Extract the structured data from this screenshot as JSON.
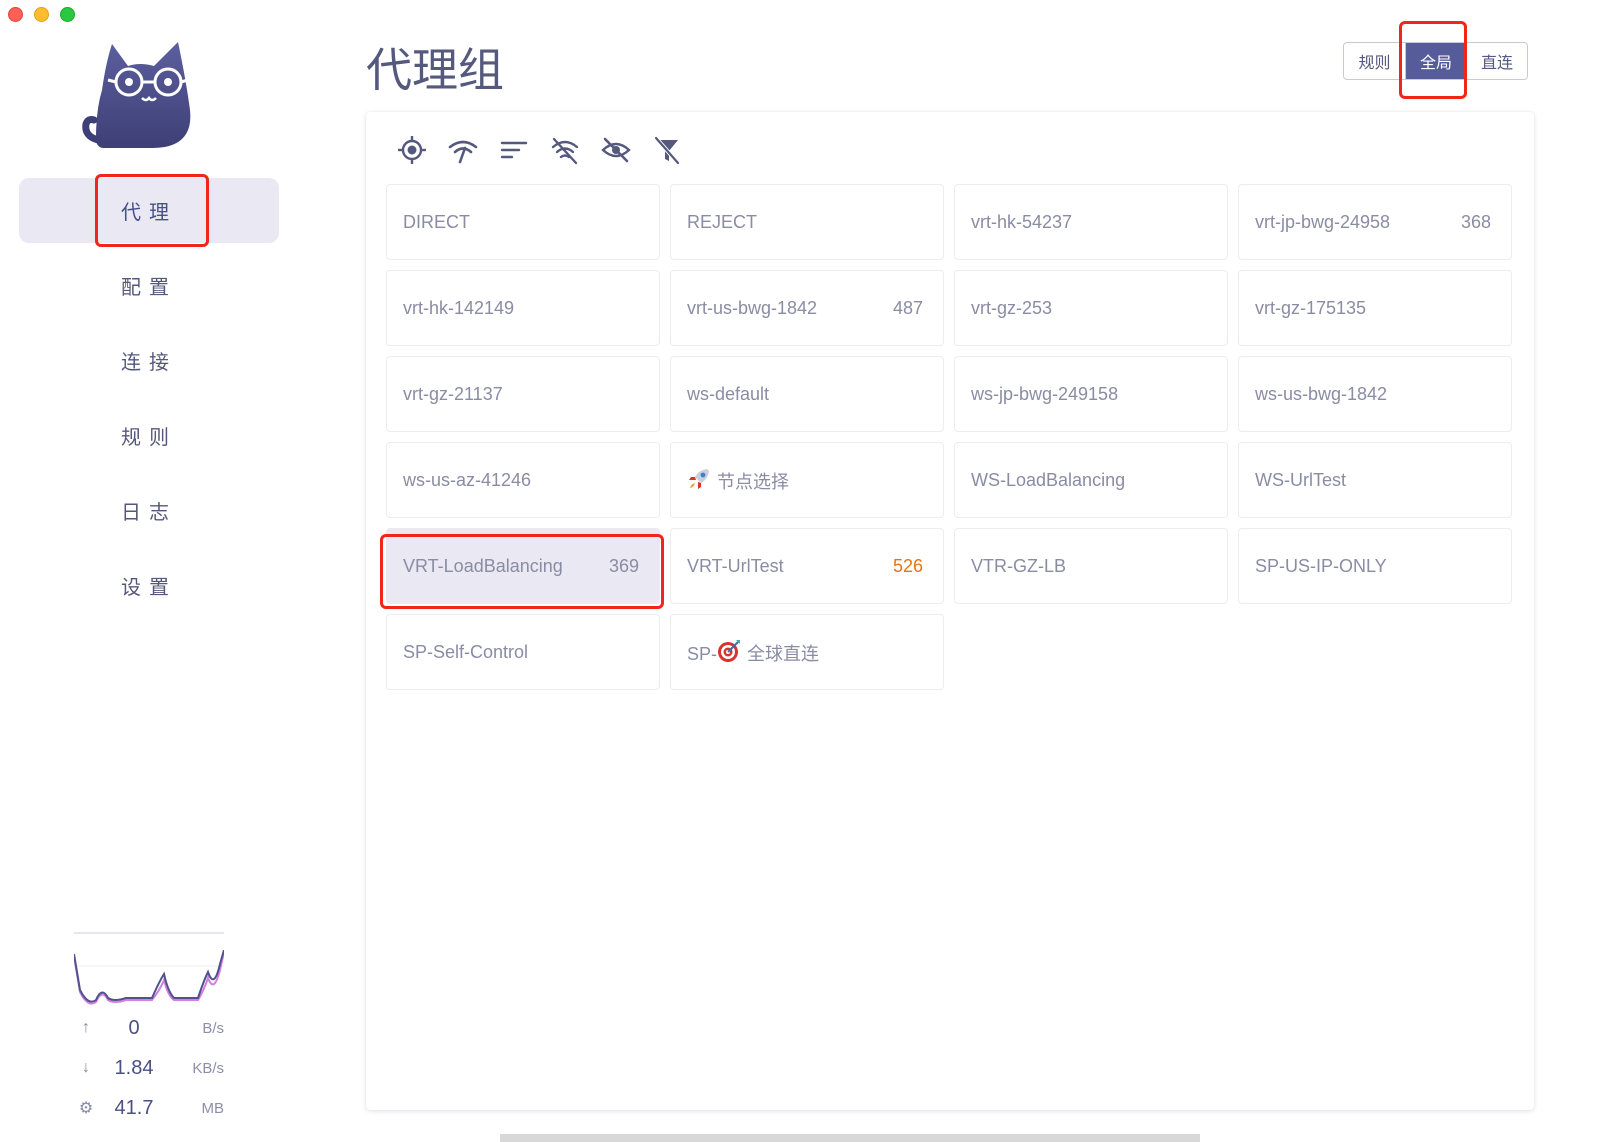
{
  "sidebar": {
    "nav": [
      {
        "label": "代理",
        "active": true
      },
      {
        "label": "配置",
        "active": false
      },
      {
        "label": "连接",
        "active": false
      },
      {
        "label": "规则",
        "active": false
      },
      {
        "label": "日志",
        "active": false
      },
      {
        "label": "设置",
        "active": false
      }
    ],
    "stats": {
      "upload": {
        "value": "0",
        "unit": "B/s",
        "icon": "arrow-up-icon"
      },
      "download": {
        "value": "1.84",
        "unit": "KB/s",
        "icon": "arrow-down-icon"
      },
      "memory": {
        "value": "41.7",
        "unit": "MB",
        "icon": "chip-icon"
      }
    }
  },
  "main": {
    "title": "代理组",
    "modes": [
      {
        "label": "规则",
        "active": false
      },
      {
        "label": "全局",
        "active": true
      },
      {
        "label": "直连",
        "active": false
      }
    ],
    "toolbar": [
      "target-icon",
      "speedtest-icon",
      "sort-icon",
      "hide-unavailable-icon",
      "hide-icon",
      "filter-off-icon"
    ],
    "proxies": [
      {
        "name": "DIRECT",
        "delay": ""
      },
      {
        "name": "REJECT",
        "delay": ""
      },
      {
        "name": "vrt-hk-54237",
        "delay": ""
      },
      {
        "name": "vrt-jp-bwg-24958",
        "delay": "368"
      },
      {
        "name": "vrt-hk-142149",
        "delay": ""
      },
      {
        "name": "vrt-us-bwg-1842",
        "delay": "487"
      },
      {
        "name": "vrt-gz-253",
        "delay": ""
      },
      {
        "name": "vrt-gz-175135",
        "delay": ""
      },
      {
        "name": "vrt-gz-21137",
        "delay": ""
      },
      {
        "name": "ws-default",
        "delay": ""
      },
      {
        "name": "ws-jp-bwg-249158",
        "delay": ""
      },
      {
        "name": "ws-us-bwg-1842",
        "delay": ""
      },
      {
        "name": "ws-us-az-41246",
        "delay": ""
      },
      {
        "name": "节点选择",
        "delay": "",
        "icon": "rocket-icon"
      },
      {
        "name": "WS-LoadBalancing",
        "delay": ""
      },
      {
        "name": "WS-UrlTest",
        "delay": ""
      },
      {
        "name": "VRT-LoadBalancing",
        "delay": "369",
        "selected": true
      },
      {
        "name": "VRT-UrlTest",
        "delay": "526",
        "warn": true
      },
      {
        "name": "VTR-GZ-LB",
        "delay": ""
      },
      {
        "name": "SP-US-IP-ONLY",
        "delay": ""
      },
      {
        "name": "SP-Self-Control",
        "delay": ""
      },
      {
        "name": "全球直连",
        "prefix": "SP-",
        "delay": "",
        "icon": "target-emoji-icon"
      }
    ]
  },
  "colors": {
    "accent": "#565b99",
    "nav_active_bg": "#e9e8f3",
    "highlight": "#f0261c",
    "warn": "#e4760f"
  }
}
